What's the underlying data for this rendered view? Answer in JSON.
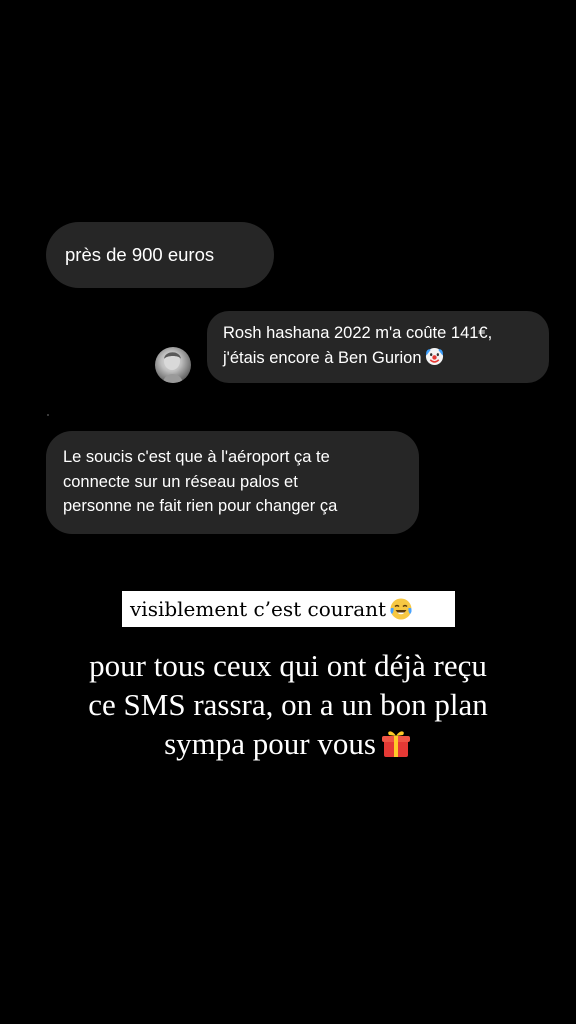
{
  "messages": [
    {
      "sender": "other",
      "lines": [
        "près de 900 euros"
      ]
    },
    {
      "sender": "me",
      "lines": [
        "Rosh hashana 2022 m'a coûte 141€,",
        "j'étais encore à Ben Gurion"
      ],
      "emoji": "clown-face-icon"
    },
    {
      "sender": "other",
      "lines": [
        "Le soucis c'est que à l'aéroport ça te",
        "connecte sur un réseau palos et",
        "personne ne fait rien pour changer ça"
      ]
    }
  ],
  "caption": {
    "label": "visiblement c’est courant",
    "emoji": "tears-of-joy-icon"
  },
  "story_text": {
    "lines": [
      "pour tous ceux qui ont déjà reçu",
      "ce SMS rassra, on a un bon plan",
      "sympa pour vous"
    ],
    "emoji": "gift-icon"
  },
  "colors": {
    "background": "#000000",
    "bubble": "#262626",
    "text": "#ffffff",
    "caption_bg": "#ffffff",
    "caption_text": "#000000"
  }
}
